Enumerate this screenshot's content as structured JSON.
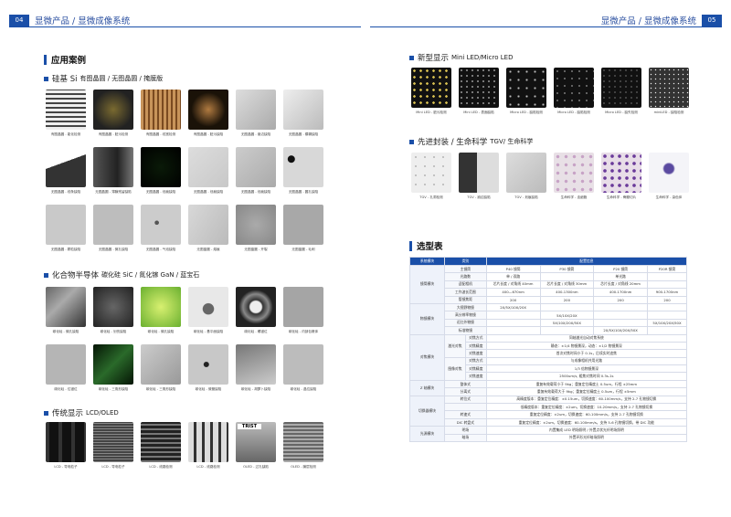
{
  "left": {
    "page_num": "04",
    "header": "显微产品 / 显微成像系统",
    "section_title": "应用案例",
    "groups": [
      {
        "title_big": "硅基 Si",
        "title_small": "有图晶圆 / 无图晶圆 / 掩膜版",
        "items": [
          "有图晶圆 - 能化检测",
          "有图晶圆 - 脏污检测",
          "有图晶圆 - 线宽检测",
          "有图晶圆 - 脏污缺陷",
          "无图晶圆 - 崩边缺陷",
          "无图晶圆 - 模糊缺陷",
          "无图晶圆 - 线条缺陷",
          "无图晶圆 - 薄膜残留缺陷",
          "无图晶圆 - 划痕缺陷",
          "无图晶圆 - 划痕缺陷",
          "无图晶圆 - 划痕缺陷",
          "无图晶圆 - 圆孔缺陷",
          "无图晶圆 - 颗粒缺陷",
          "无图晶圆 - 微孔缺陷",
          "无图晶圆 - 气泡缺陷",
          "无图晶圆 - 熔痕",
          "无图晶圆 - 开裂",
          "无图晶圆 - 毛刺"
        ]
      },
      {
        "title_big": "化合物半导体",
        "title_small": "碳化硅 SiC / 氮化镓 GaN / 蓝宝石",
        "items": [
          "碳化硅 - 微孔缺陷",
          "碳化硅 - 划伤缺陷",
          "碳化硅 - 微孔缺陷",
          "碳化硅 - 基平面缺陷",
          "碳化硅 - 螺错位",
          "碳化硅 - 内部包裹体",
          "碳化硅 - 位错位",
          "碳化硅 - 三角形缺陷",
          "碳化硅 - 三角形缺陷",
          "碳化硅 - 微管缺陷",
          "碳化硅 - 胡萝卜缺陷",
          "碳化硅 - 晶位缺陷"
        ]
      },
      {
        "title_big": "传统显示",
        "title_small": "LCD/OLED",
        "items": [
          "LCD - 导电粒子",
          "LCD - 导电粒子",
          "LCD - 线路检测",
          "LCD - 线路检测",
          "OLED - 过孔缺陷",
          "OLED - 膜层检测"
        ]
      }
    ],
    "img_label": "TRIST"
  },
  "right": {
    "page_num": "05",
    "header": "显微产品 / 显微成像系统",
    "groups": [
      {
        "title_big": "新型显示",
        "title_small": "Mini LED/Micro LED",
        "items": [
          "Mini LED - 脏污检测",
          "Mini LED - 表面缺陷",
          "Micro LED - 缺陷检测",
          "Micro LED - 缺陷检测",
          "Micro LED - 缺失检测",
          "miniLED - 缺陷检测"
        ]
      },
      {
        "title_big": "先进封装 / 生命科学",
        "title_small": "TGV/ 生命科学",
        "items": [
          "TGV - 孔洞检测",
          "TGV - 崩边缺陷",
          "TGV - 划痕缺陷",
          "生命科学 - 血细胞",
          "生命科学 - 骨髓切片",
          "生命科学 - 染色体"
        ]
      }
    ],
    "section2_title": "选型表",
    "table": {
      "head": [
        "系统模块",
        "类别",
        "配置信息"
      ],
      "rows": [
        [
          "镜筒模块",
          "",
          "主镜筒",
          "P40 镜筒",
          "P30 镜筒",
          "P20 镜筒",
          "P20R 镜筒"
        ],
        [
          "",
          "",
          "光路数",
          "单 / 双路",
          "",
          "单光路",
          ""
        ],
        [
          "",
          "",
          "适配相机",
          "芯片长度 / 对角线 40mm",
          "芯片长度 / 对角线 30mm",
          "芯片长度 / 对角线 20mm",
          ""
        ],
        [
          "",
          "",
          "工作波长范围",
          "400—670nm",
          "400-1300nm",
          "400-1700nm",
          "900-1700nm"
        ],
        [
          "",
          "",
          "管镜焦距",
          "200",
          "200",
          "200",
          "200"
        ],
        [
          "物镜模块",
          "",
          "大视野物镜",
          "2X/5X/10X/20X",
          "",
          "",
          ""
        ],
        [
          "",
          "",
          "高分辨率物镜",
          "",
          "5X/10X/20X",
          "",
          ""
        ],
        [
          "",
          "",
          "近红外物镜",
          "",
          "5X/10X/20X/50X",
          "",
          "5X/10X/20X/50X"
        ],
        [
          "",
          "",
          "标准物镜",
          "",
          "",
          "2X/5X/10X/20X/50X",
          ""
        ],
        [
          "对焦模块",
          "激光对焦",
          "对焦方式",
          "同轴激光自动对焦系统",
          "",
          "",
          ""
        ],
        [
          "",
          "",
          "对焦精度",
          "静态：±1/4 物镜景深，动态：±1/2 物镜景深",
          "",
          "",
          ""
        ],
        [
          "",
          "",
          "对焦速度",
          "首次对焦时间小于 0.1s，后续实时追焦",
          "",
          "",
          ""
        ],
        [
          "",
          "图像对焦",
          "对焦方式",
          "与成像相机共用光路",
          "",
          "",
          ""
        ],
        [
          "",
          "",
          "对焦精度",
          "1/3 倍物镜景深",
          "",
          "",
          ""
        ],
        [
          "",
          "",
          "对焦速度",
          "2500um/s, 粗焦对焦时间 0.3s-1s",
          "",
          "",
          ""
        ],
        [
          "Z 轴模块",
          "",
          "整体式",
          "重复有效载荷小于 9kg；重复定位精度土 0.5um，行程 ±25mm",
          "",
          "",
          ""
        ],
        [
          "",
          "",
          "分离式",
          "重复有效载荷大于 9kg；重复定位精度土 0.5um，行程 ±5mm",
          "",
          "",
          ""
        ],
        [
          "切换器模块",
          "",
          "转位式",
          "高精度版本：重复定位精度：±0.15um，切换速度：60-100mm/s，支持 2-7 孔物镜切换",
          "",
          "",
          ""
        ],
        [
          "",
          "",
          "",
          "低精度版本：重复定位精度：±2um，切换速度：10-20mm/s，支持 2-7 孔物镜切换",
          "",
          "",
          ""
        ],
        [
          "",
          "",
          "转速式",
          "重复定位精度：±2um，切换速度：60-100mm/s，支持 2-7 孔物镜切换",
          "",
          "",
          ""
        ],
        [
          "",
          "",
          "DIC 转盘式",
          "重复定位精度：±2um，切换速度：60-100mm/s，支持 5-6 孔物镜切换，带 DIC 功能",
          "",
          "",
          ""
        ],
        [
          "光源模块",
          "",
          "明场",
          "内置集成 LED 明场照明 / 外置点状光纤明场照明",
          "",
          "",
          ""
        ],
        [
          "",
          "",
          "暗场",
          "外置环形光纤暗场照明",
          "",
          "",
          ""
        ]
      ]
    }
  }
}
